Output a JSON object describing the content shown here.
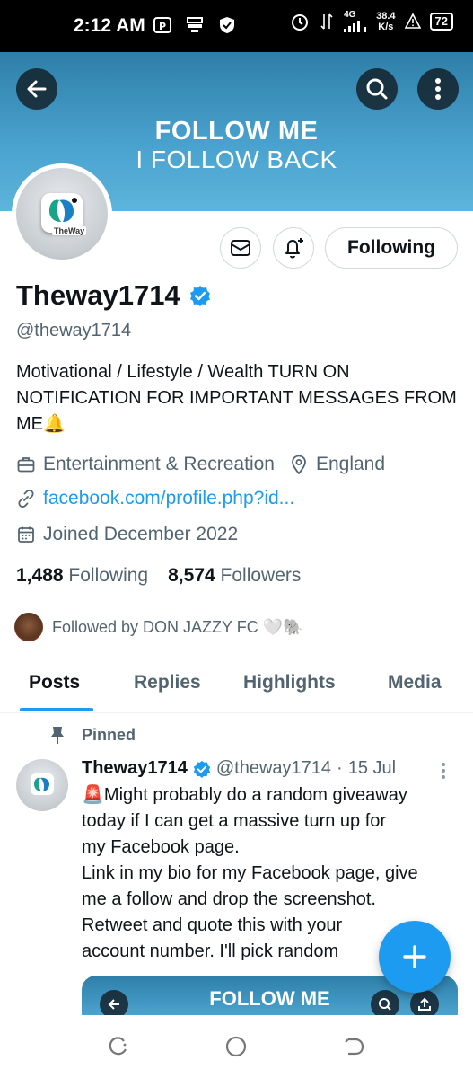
{
  "status_bar": {
    "time": "2:12 AM",
    "network": "4G",
    "speed_value": "38.4",
    "speed_unit": "K/s",
    "battery": "72"
  },
  "header": {
    "banner_line1": "FOLLOW ME",
    "banner_line2": "I FOLLOW BACK",
    "icons": [
      "back-arrow-icon",
      "search-icon",
      "more-vertical-icon"
    ]
  },
  "profile": {
    "avatar_logo_text": "TheWay",
    "following_button": "Following",
    "name": "Theway1714",
    "handle": "@theway1714",
    "bio": "Motivational / Lifestyle / Wealth   TURN ON NOTIFICATION FOR IMPORTANT MESSAGES FROM ME🔔",
    "category": "Entertainment & Recreation",
    "location": "England",
    "website": "facebook.com/profile.php?id...",
    "joined": "Joined December 2022",
    "following_count": "1,488",
    "following_label": "Following",
    "followers_count": "8,574",
    "followers_label": "Followers",
    "followed_by": "Followed by DON JAZZY FC 🤍🐘"
  },
  "tabs": [
    {
      "label": "Posts",
      "active": true
    },
    {
      "label": "Replies",
      "active": false
    },
    {
      "label": "Highlights",
      "active": false
    },
    {
      "label": "Media",
      "active": false
    }
  ],
  "pinned_tweet": {
    "pinned_label": "Pinned",
    "author_name": "Theway1714",
    "author_handle": "@theway1714",
    "separator": "·",
    "date": "15 Jul",
    "body_lines": [
      "🚨Might probably do a random giveaway",
      "today if I can get a massive turn up for",
      "my Facebook page.",
      "Link in my bio for my Facebook page, give",
      "me a follow and drop the screenshot.",
      "Retweet and quote this with your",
      "account number. I'll pick random"
    ],
    "media_title": "FOLLOW ME"
  },
  "colors": {
    "accent": "#1d9bf0",
    "banner": "#4aa3cf",
    "text_primary": "#0f1419",
    "text_secondary": "#536471"
  }
}
